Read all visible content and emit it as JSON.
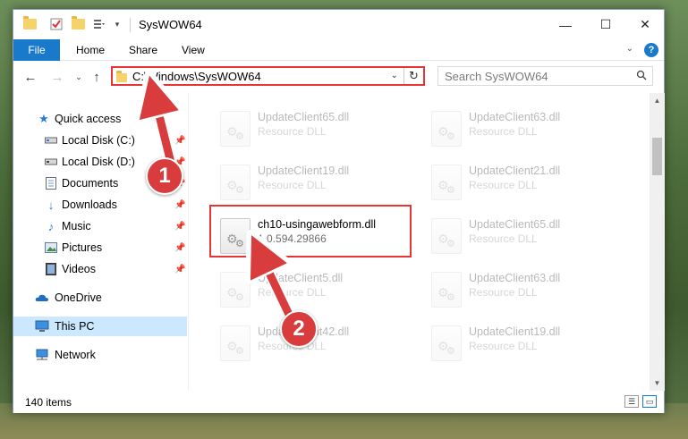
{
  "window": {
    "title": "SysWOW64",
    "minimize": "—",
    "maximize": "☐",
    "close": "✕"
  },
  "ribbon": {
    "tabs": [
      "File",
      "Home",
      "Share",
      "View"
    ],
    "help": "?"
  },
  "navbar": {
    "address": "C:\\Windows\\SysWOW64",
    "search_placeholder": "Search SysWOW64"
  },
  "sidebar": {
    "items": [
      {
        "label": "Quick access",
        "icon": "star-icon"
      },
      {
        "label": "Local Disk (C:)",
        "icon": "drive-icon",
        "pinned": true
      },
      {
        "label": "Local Disk (D:)",
        "icon": "drive-icon",
        "pinned": true
      },
      {
        "label": "Documents",
        "icon": "documents-icon",
        "pinned": true
      },
      {
        "label": "Downloads",
        "icon": "downloads-icon",
        "pinned": true
      },
      {
        "label": "Music",
        "icon": "music-icon",
        "pinned": true
      },
      {
        "label": "Pictures",
        "icon": "pictures-icon",
        "pinned": true
      },
      {
        "label": "Videos",
        "icon": "videos-icon",
        "pinned": true
      },
      {
        "label": "OneDrive",
        "icon": "cloud-icon"
      },
      {
        "label": "This PC",
        "icon": "computer-icon",
        "selected": true
      },
      {
        "label": "Network",
        "icon": "network-icon"
      }
    ]
  },
  "files": [
    {
      "name": "UpdateClient65.dll",
      "desc": "Resource DLL"
    },
    {
      "name": "UpdateClient63.dll",
      "desc": "Resource DLL"
    },
    {
      "name": "UpdateClient19.dll",
      "desc": "Resource DLL"
    },
    {
      "name": "UpdateClient21.dll",
      "desc": "Resource DLL"
    },
    {
      "name": "ch10-usingawebform.dll",
      "desc": "1.0.594.29866"
    },
    {
      "name": "UpdateClient65.dll",
      "desc": "Resource DLL"
    },
    {
      "name": "UpdateClient5.dll",
      "desc": "Resource DLL"
    },
    {
      "name": "UpdateClient63.dll",
      "desc": "Resource DLL"
    },
    {
      "name": "UpdateClient42.dll",
      "desc": "Resource DLL"
    },
    {
      "name": "UpdateClient19.dll",
      "desc": "Resource DLL"
    }
  ],
  "status": {
    "item_count": "140 items"
  },
  "annotations": {
    "step1": "1",
    "step2": "2"
  },
  "colors": {
    "accent": "#1979ca",
    "highlight": "#e53535",
    "badge": "#d83c3c",
    "selected": "#cce8ff"
  }
}
